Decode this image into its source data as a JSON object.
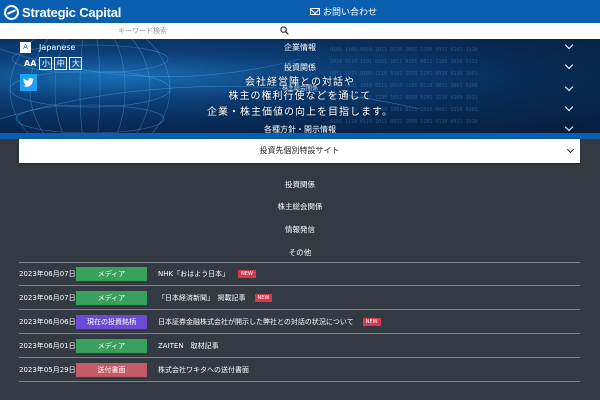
{
  "header": {
    "logo": "Strategic Capital",
    "contact_label": "お問い合わせ",
    "contact_icon": "mail-icon",
    "brand_color": "#0a5fb0"
  },
  "search": {
    "placeholder": "キーワード検索",
    "value": ""
  },
  "language": {
    "label": "Japanese"
  },
  "font_size": {
    "icon": "AA",
    "options": [
      "小",
      "中",
      "大"
    ]
  },
  "hero": {
    "lines": [
      "会社経営陣との対話や",
      "株主の権利行使などを通じて",
      "企業・株主価値の向上を目指します。"
    ]
  },
  "nav": {
    "items": [
      "企業情報",
      "投資関係",
      "株主総会関係",
      "各種方針・開示情報"
    ]
  },
  "dropdown": {
    "label": "投資先個別特設サイト"
  },
  "sublinks": [
    "投資関係",
    "株主総会関係",
    "情報発信",
    "その他"
  ],
  "news": [
    {
      "date": "2023年06月07日",
      "tag": "メディア",
      "tag_type": "media",
      "title": "NHK「おはよう日本」",
      "new": "NEW"
    },
    {
      "date": "2023年06月07日",
      "tag": "メディア",
      "tag_type": "media",
      "title": "「日本経済新聞」　掲載記事",
      "new": "NEW"
    },
    {
      "date": "2023年06月06日",
      "tag": "現在の投資銘柄",
      "tag_type": "invest",
      "title": "日本証券金融株式会社が開示した弊社との対話の状況について",
      "new": "NEW"
    },
    {
      "date": "2023年06月01日",
      "tag": "メディア",
      "tag_type": "media",
      "title": "ZAITEN　取材記事",
      "new": ""
    },
    {
      "date": "2023年05月29日",
      "tag": "送付書面",
      "tag_type": "letter",
      "title": "株式会社ワキタへの送付書面",
      "new": ""
    }
  ]
}
